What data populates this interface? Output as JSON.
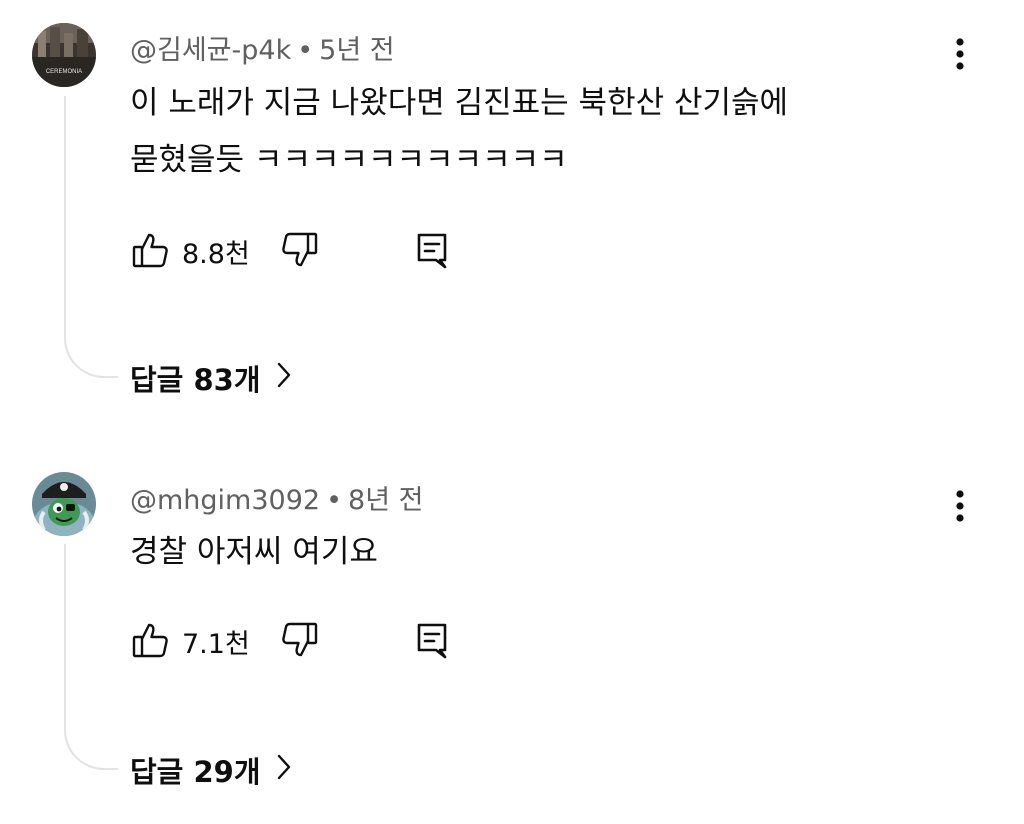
{
  "comments": [
    {
      "handle": "@김세균-p4k",
      "separator": "•",
      "time": "5년 전",
      "text_lines": [
        "이 노래가 지금 나왔다면 김진표는 북한산 산기슭에",
        "묻혔을듯 ㅋㅋㅋㅋㅋㅋㅋㅋㅋㅋㅋ"
      ],
      "likes": "8.8천",
      "replies_label": "답글 83개",
      "avatar_icon": "ceremonia-album-avatar",
      "avatar_text": "CEREMONIA"
    },
    {
      "handle": "@mhgim3092",
      "separator": "•",
      "time": "8년 전",
      "text_lines": [
        "경찰 아저씨 여기요"
      ],
      "likes": "7.1천",
      "replies_label": "답글 29개",
      "avatar_icon": "pirate-cartoon-avatar"
    }
  ],
  "icons": {
    "like": "thumbs-up-icon",
    "dislike": "thumbs-down-icon",
    "reply": "reply-comment-icon",
    "more": "more-vertical-icon",
    "chevron": "chevron-right-icon"
  },
  "colors": {
    "text": "#0f0f0f",
    "meta": "#606060",
    "thread_line": "#e3e3e3"
  }
}
